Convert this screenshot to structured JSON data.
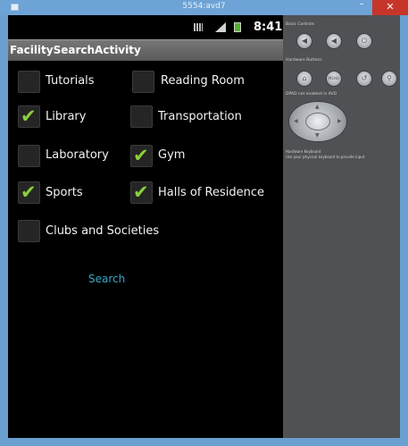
{
  "window": {
    "title": "5554:avd7",
    "minimize_glyph": "–",
    "close_glyph": "✕"
  },
  "statusbar": {
    "time": "8:41"
  },
  "app": {
    "title": "FacilitySearchActivity"
  },
  "facilities": [
    {
      "label": "Tutorials",
      "checked": false
    },
    {
      "label": "Reading Room",
      "checked": false
    },
    {
      "label": "Library",
      "checked": true
    },
    {
      "label": "Transportation",
      "checked": false
    },
    {
      "label": "Laboratory",
      "checked": false
    },
    {
      "label": "Gym",
      "checked": true
    },
    {
      "label": "Sports",
      "checked": true
    },
    {
      "label": "Halls of Residence",
      "checked": true
    },
    {
      "label": "Clubs and Societies",
      "checked": false
    }
  ],
  "search_label": "Search",
  "check_glyph": "✔",
  "panel": {
    "basic_controls": "Basic Controls",
    "hardware_buttons": "Hardware Buttons",
    "dpad_note": "DPAD not enabled in AVD",
    "keyboard_title": "Hardware Keyboard",
    "keyboard_note": "Use your physical keyboard to provide input",
    "menu_label": "MENU"
  }
}
